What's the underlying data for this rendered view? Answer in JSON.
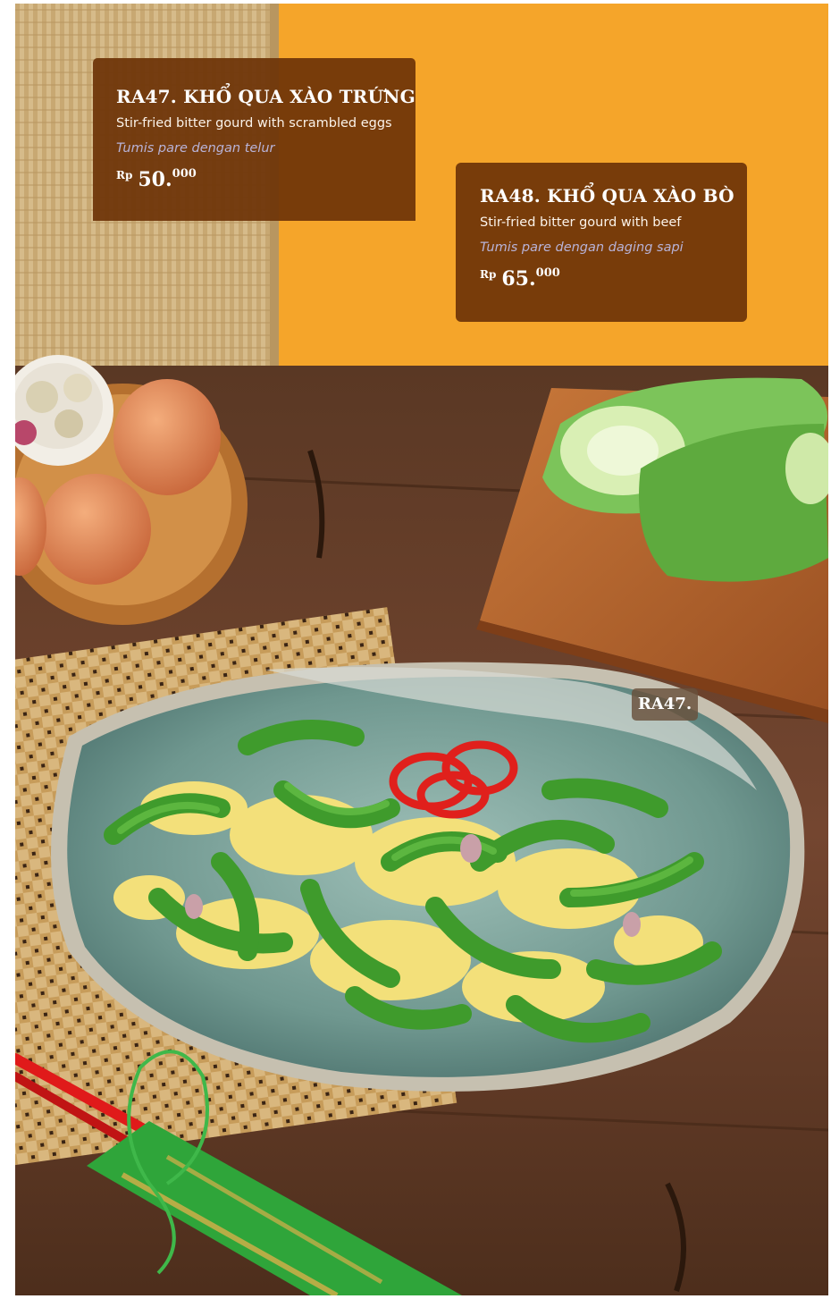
{
  "items": [
    {
      "title": "RA47. KHỔ QUA XÀO TRỨNG",
      "english": "Stir-fried bitter gourd with scrambled eggs",
      "indonesian": "Tumis pare dengan telur",
      "price": {
        "currency": "Rp",
        "main": "50.",
        "thousands": "000"
      }
    },
    {
      "title": "RA48. KHỔ QUA XÀO BÒ",
      "english": "Stir-fried bitter gourd with beef",
      "indonesian": "Tumis pare dengan daging sapi",
      "price": {
        "currency": "Rp",
        "main": "65.",
        "thousands": "000"
      }
    }
  ],
  "photo_tag": "RA47.",
  "colors": {
    "card_background": "#6e3408",
    "wall_orange": "#f3a126",
    "table_wood": "#6a4026",
    "plate_teal": "#7fa69e",
    "bitter_gourd_green": "#3f9b2c",
    "egg_yellow": "#f3e07a",
    "chili_red": "#e0201c"
  }
}
